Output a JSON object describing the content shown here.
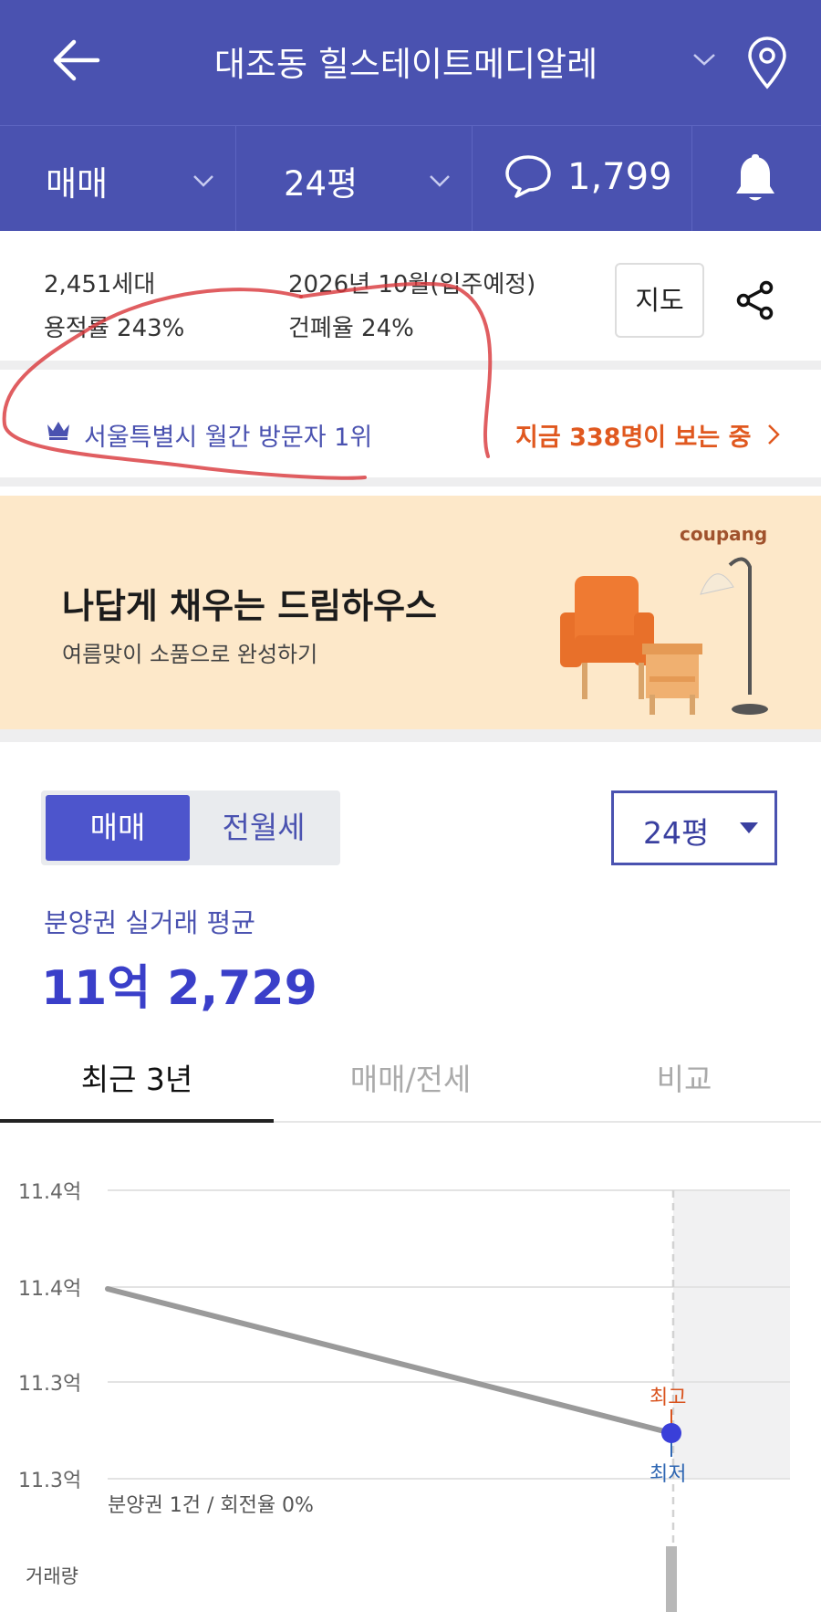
{
  "header": {
    "title": "대조동 힐스테이트메디알레",
    "back_icon": "back-arrow-icon",
    "location_icon": "location-pin-icon"
  },
  "subbar": {
    "trade_type": "매매",
    "size": "24평",
    "comment_count": "1,799",
    "bell_icon": "bell-icon"
  },
  "info": {
    "households": "2,451세대",
    "move_in": "2026년 10월(입주예정)",
    "floor_area_ratio": "용적률 243%",
    "building_coverage": "건폐율 24%",
    "map_button": "지도"
  },
  "rank": {
    "text": "서울특별시 월간 방문자 1위",
    "viewers": "지금 338명이 보는 중"
  },
  "ad": {
    "brand": "coupang",
    "headline": "나답게 채우는 드림하우스",
    "subline": "여름맞이 소품으로 완성하기"
  },
  "toggle": {
    "active": "매매",
    "inactive": "전월세"
  },
  "size_select": "24평",
  "average": {
    "label": "분양권 실거래 평균",
    "price": "11억 2,729"
  },
  "tabs": [
    "최근 3년",
    "매매/전세",
    "비교"
  ],
  "chart_data": {
    "type": "line",
    "y_tick_labels": [
      "11.4억",
      "11.4억",
      "11.3억",
      "11.3억"
    ],
    "series": [
      {
        "values": [
          11.39,
          11.33
        ]
      }
    ],
    "marker_labels": {
      "high": "최고",
      "low": "최저"
    },
    "footnote": "분양권 1건 / 회전율 0%",
    "volume_label": "거래량",
    "colors": {
      "line": "#9a9a9a",
      "marker": "#3a3fd9",
      "high": "#d9531e",
      "low": "#2f67b3"
    }
  }
}
